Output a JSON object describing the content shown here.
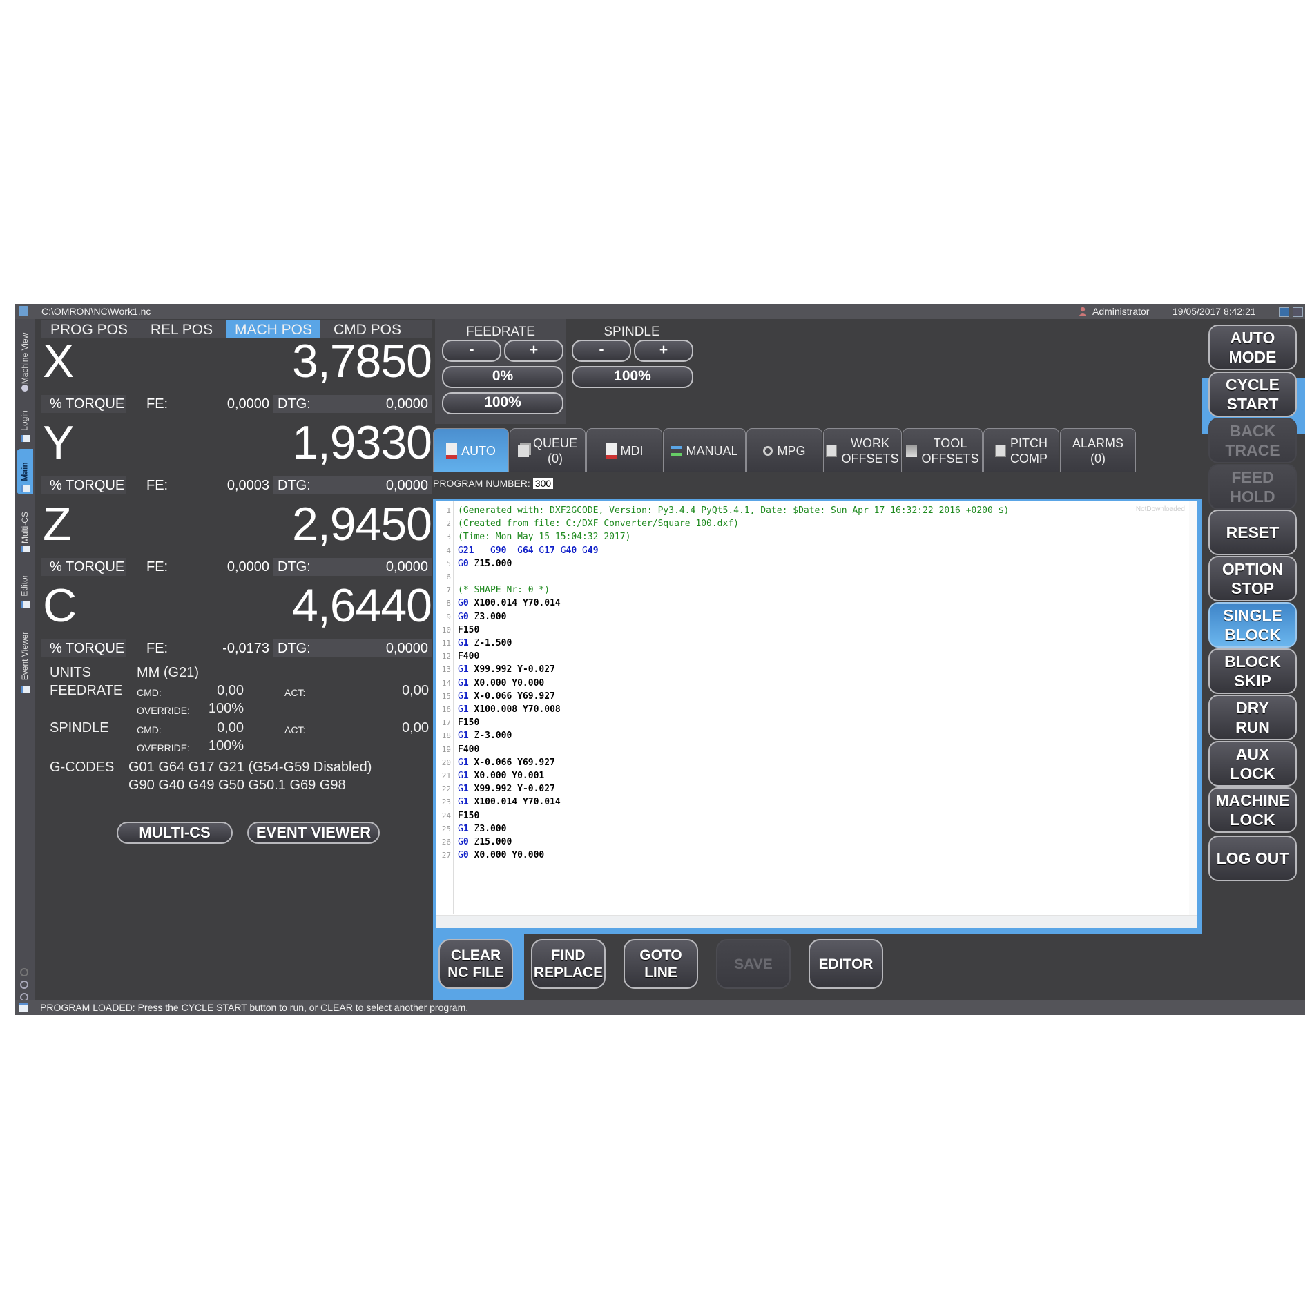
{
  "titlebar": {
    "file_path": "C:\\OMRON\\NC\\Work1.nc",
    "user": "Administrator",
    "datetime": "19/05/2017 8:42:21"
  },
  "sidebar": {
    "tabs": [
      {
        "label": "Machine View",
        "icon": "gear-icon"
      },
      {
        "label": "Login",
        "icon": "window-icon"
      },
      {
        "label": "Main",
        "icon": "window-icon",
        "active": true
      },
      {
        "label": "Multi-CS",
        "icon": "window-icon"
      },
      {
        "label": "Editor",
        "icon": "window-icon"
      },
      {
        "label": "Event Viewer",
        "icon": "window-icon"
      }
    ],
    "bottom_icons": [
      "refresh-icon",
      "zoom-in-icon",
      "zoom-out-icon"
    ]
  },
  "position": {
    "tabs": [
      {
        "label": "PROG POS"
      },
      {
        "label": "REL POS"
      },
      {
        "label": "MACH POS",
        "active": true
      },
      {
        "label": "CMD POS"
      }
    ],
    "axes": [
      {
        "name": "X",
        "value": "3,7850",
        "torque_label": "% TORQUE",
        "fe_label": "FE:",
        "fe": "0,0000",
        "dtg_label": "DTG:",
        "dtg": "0,0000"
      },
      {
        "name": "Y",
        "value": "1,9330",
        "torque_label": "% TORQUE",
        "fe_label": "FE:",
        "fe": "0,0003",
        "dtg_label": "DTG:",
        "dtg": "0,0000"
      },
      {
        "name": "Z",
        "value": "2,9450",
        "torque_label": "% TORQUE",
        "fe_label": "FE:",
        "fe": "0,0000",
        "dtg_label": "DTG:",
        "dtg": "0,0000"
      },
      {
        "name": "C",
        "value": "4,6440",
        "torque_label": "% TORQUE",
        "fe_label": "FE:",
        "fe": "-0,0173",
        "dtg_label": "DTG:",
        "dtg": "0,0000"
      }
    ]
  },
  "info": {
    "units_label": "UNITS",
    "units_value": "MM (G21)",
    "feedrate": {
      "label": "FEEDRATE",
      "cmd_label": "CMD:",
      "cmd": "0,00",
      "act_label": "ACT:",
      "act": "0,00",
      "override_label": "OVERRIDE:",
      "override": "100%"
    },
    "spindle": {
      "label": "SPINDLE",
      "cmd_label": "CMD:",
      "cmd": "0,00",
      "act_label": "ACT:",
      "act": "0,00",
      "override_label": "OVERRIDE:",
      "override": "100%"
    },
    "gcodes_label": "G-CODES",
    "gcodes_line1": "G01 G64 G17 G21 (G54-G59 Disabled)",
    "gcodes_line2": "G90 G40 G49 G50 G50.1 G69 G98"
  },
  "left_buttons": {
    "multi_cs": "MULTI-CS",
    "event_viewer": "EVENT VIEWER"
  },
  "feedrate_panel": {
    "title": "FEEDRATE",
    "minus": "-",
    "plus": "+",
    "current": "0%",
    "reset": "100%"
  },
  "spindle_panel": {
    "title": "SPINDLE",
    "minus": "-",
    "plus": "+",
    "current": "100%"
  },
  "mode_tabs": [
    {
      "label": "AUTO",
      "icon": "auto-doc-icon",
      "active": true
    },
    {
      "label": "QUEUE",
      "sub": "(0)",
      "icon": "queue-icon"
    },
    {
      "label": "MDI",
      "icon": "mdi-doc-icon"
    },
    {
      "label": "MANUAL",
      "icon": "arrows-icon"
    },
    {
      "label": "MPG",
      "icon": "handwheel-icon"
    },
    {
      "label": "WORK",
      "sub": "OFFSETS",
      "icon": "work-offsets-icon"
    },
    {
      "label": "TOOL",
      "sub": "OFFSETS",
      "icon": "tool-offsets-icon"
    },
    {
      "label": "PITCH",
      "sub": "COMP",
      "icon": "pitch-comp-icon"
    },
    {
      "label": "ALARMS",
      "sub": "(0)"
    }
  ],
  "program": {
    "number_label": "PROGRAM NUMBER:",
    "number": "300",
    "download_state": "NotDownloaded"
  },
  "code_lines": [
    "(Generated with: DXF2GCODE, Version: Py3.4.4 PyQt5.4.1, Date: $Date: Sun Apr 17 16:32:22 2016 +0200 $)",
    "(Created from file: C:/DXF Converter/Square 100.dxf)",
    "(Time: Mon May 15 15:04:32 2017)",
    "G21   G90  G64 G17 G40 G49",
    "G0 Z15.000",
    "",
    "(* SHAPE Nr: 0 *)",
    "G0 X100.014 Y70.014",
    "G0 Z3.000",
    "F150",
    "G1 Z-1.500",
    "F400",
    "G1 X99.992 Y-0.027",
    "G1 X0.000 Y0.000",
    "G1 X-0.066 Y69.927",
    "G1 X100.008 Y70.008",
    "F150",
    "G1 Z-3.000",
    "F400",
    "G1 X-0.066 Y69.927",
    "G1 X0.000 Y0.001",
    "G1 X99.992 Y-0.027",
    "G1 X100.014 Y70.014",
    "F150",
    "G1 Z3.000",
    "G0 Z15.000",
    "G0 X0.000 Y0.000"
  ],
  "editor_buttons": [
    {
      "label": "CLEAR\nNC FILE",
      "highlight": true
    },
    {
      "label": "FIND\nREPLACE"
    },
    {
      "label": "GOTO\nLINE"
    },
    {
      "label": "SAVE",
      "disabled": true
    },
    {
      "label": "EDITOR"
    }
  ],
  "right_buttons": [
    {
      "label": "AUTO\nMODE"
    },
    {
      "label": "CYCLE\nSTART",
      "highlight": true
    },
    {
      "label": "BACK\nTRACE",
      "disabled": true
    },
    {
      "label": "FEED\nHOLD",
      "disabled": true
    },
    {
      "label": "RESET"
    },
    {
      "label": "OPTION\nSTOP"
    },
    {
      "label": "SINGLE\nBLOCK",
      "active": true
    },
    {
      "label": "BLOCK\nSKIP"
    },
    {
      "label": "DRY\nRUN"
    },
    {
      "label": "AUX\nLOCK"
    },
    {
      "label": "MACHINE\nLOCK"
    },
    {
      "label": "LOG OUT"
    }
  ],
  "status": {
    "message": "PROGRAM LOADED:  Press the CYCLE START button to run, or CLEAR to select another program."
  },
  "colors": {
    "accent_blue": "#5aa5e6",
    "comment_green": "#1f8a1f",
    "gcode_blue": "#1020c8",
    "panel_bg": "#3f3f41"
  }
}
